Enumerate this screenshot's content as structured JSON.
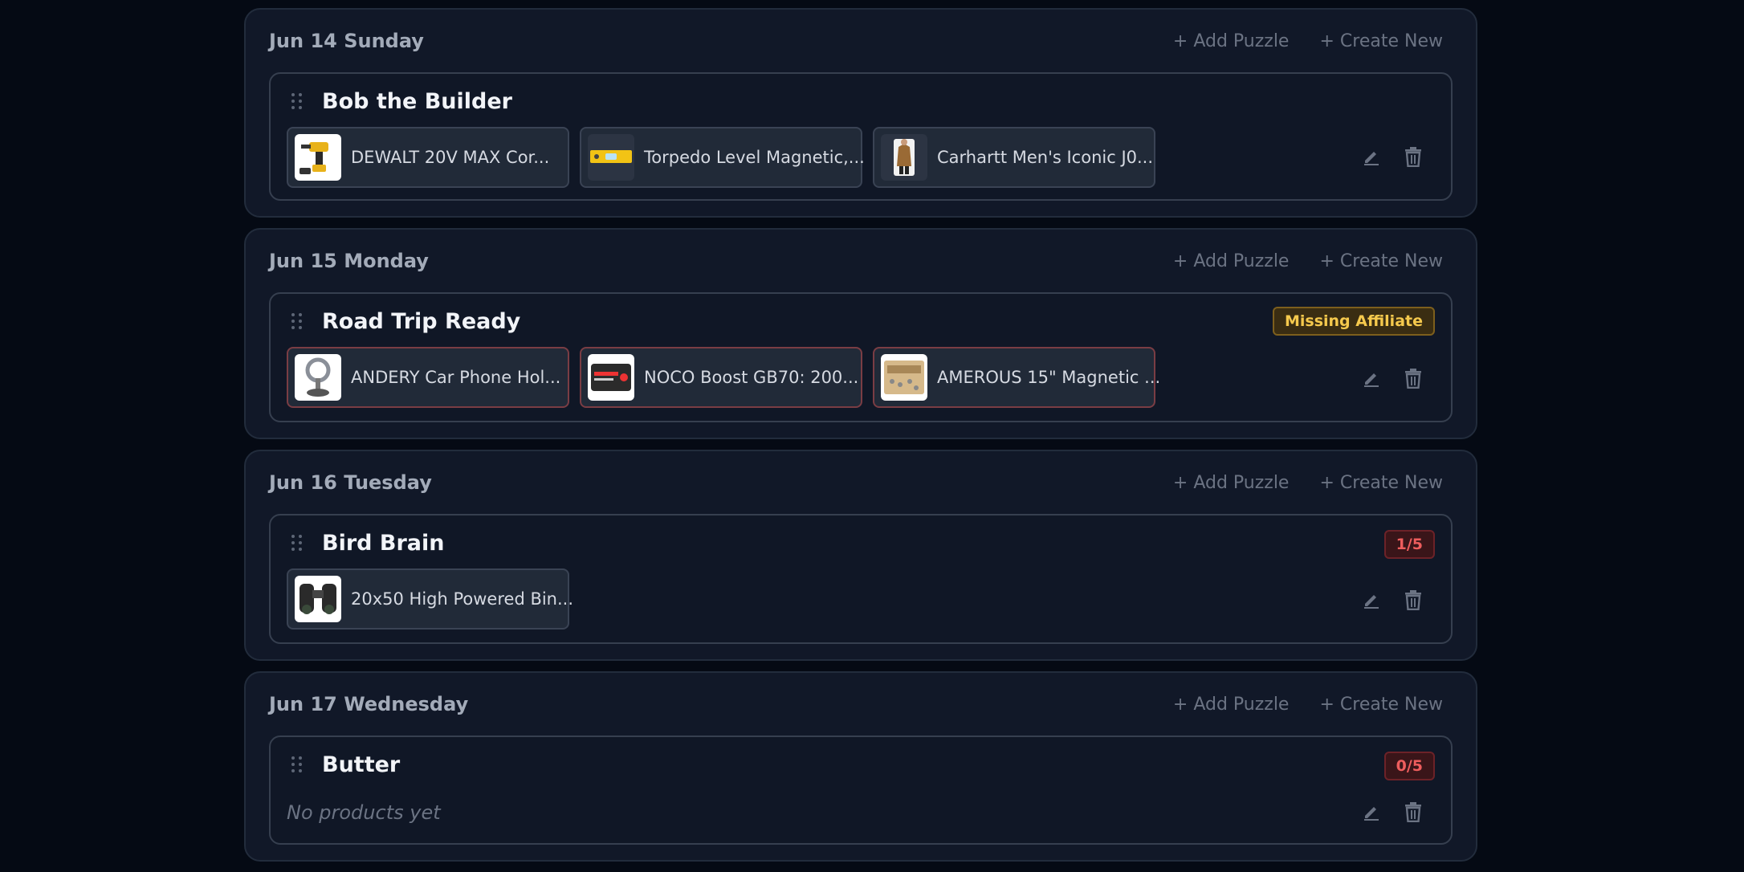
{
  "actions": {
    "add_puzzle": "+ Add Puzzle",
    "create_new": "+ Create New"
  },
  "colors": {
    "background": "#050a14",
    "card": "#111828",
    "warning": "#f5c94d",
    "error": "#ee5d5d"
  },
  "days": [
    {
      "title": "Jun 14 Sunday",
      "puzzle": {
        "name": "Bob the Builder",
        "products": [
          {
            "label": "DEWALT 20V MAX Cor...",
            "icon": "drill-thumbnail"
          },
          {
            "label": "Torpedo Level Magnetic,...",
            "icon": "level-thumbnail"
          },
          {
            "label": "Carhartt Men's Iconic J0...",
            "icon": "jacket-thumbnail"
          }
        ]
      }
    },
    {
      "title": "Jun 15 Monday",
      "puzzle": {
        "name": "Road Trip Ready",
        "badge": "Missing Affiliate",
        "products": [
          {
            "label": "ANDERY Car Phone Hol...",
            "icon": "phone-holder-thumbnail"
          },
          {
            "label": "NOCO Boost GB70: 200...",
            "icon": "jump-starter-thumbnail"
          },
          {
            "label": "AMEROUS 15\" Magnetic ...",
            "icon": "magnetic-tray-thumbnail"
          }
        ]
      }
    },
    {
      "title": "Jun 16 Tuesday",
      "puzzle": {
        "name": "Bird Brain",
        "badge": "1/5",
        "products": [
          {
            "label": "20x50 High Powered Bin...",
            "icon": "binoculars-thumbnail"
          }
        ]
      }
    },
    {
      "title": "Jun 17 Wednesday",
      "puzzle": {
        "name": "Butter",
        "badge": "0/5",
        "empty_text": "No products yet"
      }
    }
  ]
}
